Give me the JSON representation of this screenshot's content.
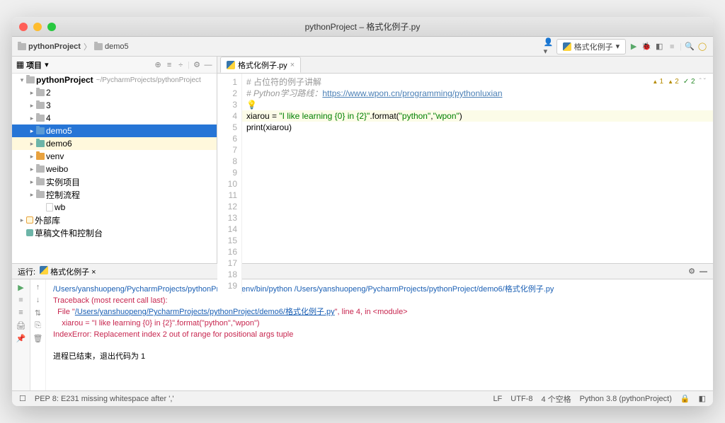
{
  "title": "pythonProject – 格式化例子.py",
  "breadcrumb": {
    "item1": "pythonProject",
    "item2": "demo5"
  },
  "config_selector": "格式化例子",
  "sidebar": {
    "panel_title": "项目",
    "root": "pythonProject",
    "root_meta": "~/PycharmProjects/pythonProject",
    "items": [
      "2",
      "3",
      "4",
      "demo5",
      "demo6",
      "venv",
      "weibo",
      "实例项目",
      "控制流程",
      "wb",
      "外部库",
      "草稿文件和控制台"
    ]
  },
  "editor": {
    "tab_name": "格式化例子.py",
    "lines": {
      "l1_comment": "# 占位符的例子讲解",
      "l2_pre": "# Python学习路线：",
      "l2_link": "https://www.wpon.cn/programming/pythonluxian",
      "l4_var": "xiarou",
      "l4_eq": " = ",
      "l4_str": "\"I like learning {0} in {2}\"",
      "l4_call": ".format(",
      "l4_arg1": "\"python\"",
      "l4_comma": ",",
      "l4_arg2": "\"wpon\"",
      "l4_close": ")",
      "l5_fn": "print",
      "l5_arg": "(xiarou)"
    },
    "inspections": {
      "e": "1",
      "w": "2",
      "ok": "2"
    }
  },
  "run": {
    "header_label": "运行:",
    "config_name": "格式化例子",
    "cmd": "/Users/yanshuopeng/PycharmProjects/pythonProject/venv/bin/python /Users/yanshuopeng/PycharmProjects/pythonProject/demo6/格式化例子.py",
    "tb1": "Traceback (most recent call last):",
    "tb2_pre": "  File \"",
    "tb2_link": "/Users/yanshuopeng/PycharmProjects/pythonProject/demo6/格式化例子.py",
    "tb2_post": "\", line 4, in <module>",
    "tb3": "    xiarou = \"I like learning {0} in {2}\".format(\"python\",\"wpon\")",
    "tb4": "IndexError: Replacement index 2 out of range for positional args tuple",
    "exit": "进程已结束，退出代码为 1"
  },
  "status": {
    "left": "PEP 8: E231 missing whitespace after ','",
    "lf": "LF",
    "enc": "UTF-8",
    "indent": "4 个空格",
    "py": "Python 3.8 (pythonProject)"
  }
}
